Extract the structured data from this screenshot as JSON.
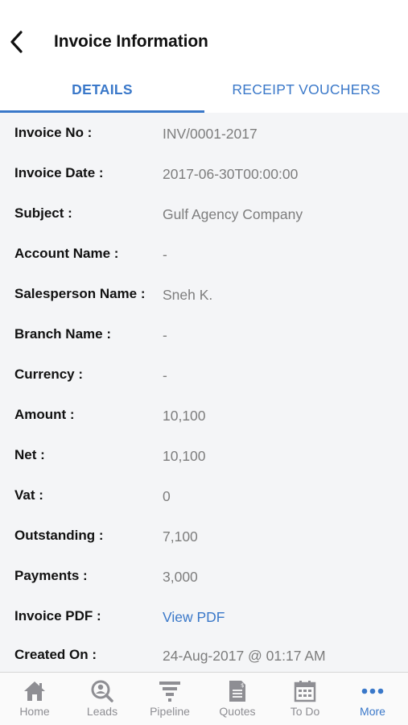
{
  "header": {
    "title": "Invoice Information",
    "back_icon": "chevron-left-icon"
  },
  "tabs": [
    {
      "label": "DETAILS",
      "active": true
    },
    {
      "label": "RECEIPT VOUCHERS",
      "active": false
    }
  ],
  "fields": [
    {
      "label": "Invoice No :",
      "value": "INV/0001-2017"
    },
    {
      "label": "Invoice Date :",
      "value": "2017-06-30T00:00:00"
    },
    {
      "label": "Subject :",
      "value": "Gulf Agency Company"
    },
    {
      "label": "Account Name :",
      "value": "-"
    },
    {
      "label": "Salesperson Name :",
      "value": "Sneh K."
    },
    {
      "label": "Branch Name :",
      "value": "-"
    },
    {
      "label": "Currency :",
      "value": "-"
    },
    {
      "label": "Amount :",
      "value": "10,100"
    },
    {
      "label": "Net :",
      "value": "10,100"
    },
    {
      "label": "Vat :",
      "value": "0"
    },
    {
      "label": "Outstanding :",
      "value": "7,100"
    },
    {
      "label": "Payments :",
      "value": "3,000"
    },
    {
      "label": "Invoice PDF :",
      "value": "View PDF",
      "is_link": true
    },
    {
      "label": "Created On :",
      "value": "24-Aug-2017 @ 01:17 AM"
    }
  ],
  "tabbar": [
    {
      "label": "Home",
      "icon": "home-icon",
      "active": false
    },
    {
      "label": "Leads",
      "icon": "leads-icon",
      "active": false
    },
    {
      "label": "Pipeline",
      "icon": "pipeline-funnel-icon",
      "active": false
    },
    {
      "label": "Quotes",
      "icon": "quotes-document-icon",
      "active": false
    },
    {
      "label": "To Do",
      "icon": "calendar-icon",
      "active": false
    },
    {
      "label": "More",
      "icon": "more-dots-icon",
      "active": true
    }
  ],
  "colors": {
    "accent": "#3a78c9",
    "inactive_icon": "#8e8e93",
    "value_text": "#7d7d7d",
    "content_bg": "#f4f5f7"
  }
}
